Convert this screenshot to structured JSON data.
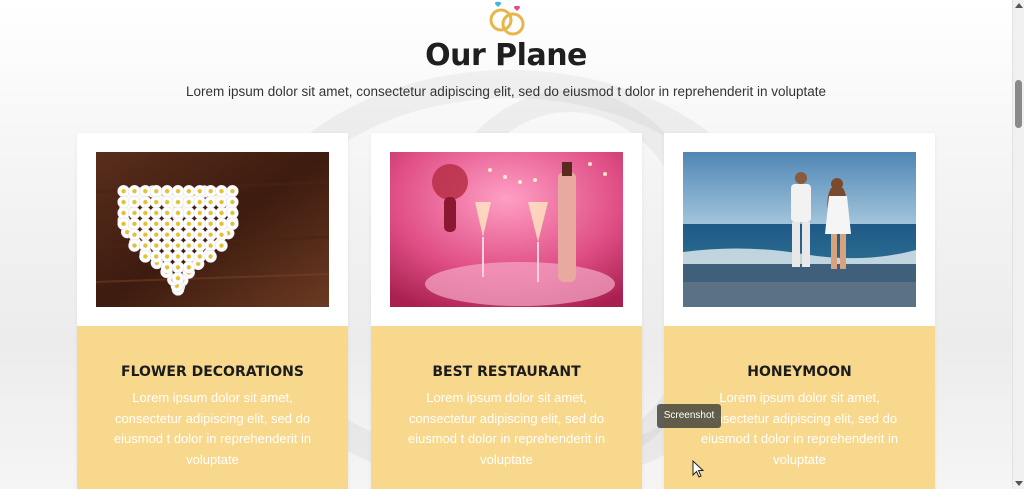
{
  "section": {
    "title": "Our Plane",
    "subtitle": "Lorem ipsum dolor sit amet, consectetur adipiscing elit, sed do eiusmod t dolor in reprehenderit in voluptate"
  },
  "cards": [
    {
      "title": "FLOWER DECORATIONS",
      "text": "Lorem ipsum dolor sit amet, consectetur adipiscing elit, sed do eiusmod t dolor in reprehenderit in voluptate",
      "image": "daisy-heart-on-wood"
    },
    {
      "title": "BEST RESTAURANT",
      "text": "Lorem ipsum dolor sit amet, consectetur adipiscing elit, sed do eiusmod t dolor in reprehenderit in voluptate",
      "image": "champagne-glasses-pink"
    },
    {
      "title": "HONEYMOON",
      "text": "Lorem ipsum dolor sit amet, consectetur adipiscing elit, sed do eiusmod t dolor in reprehenderit in voluptate",
      "image": "couple-on-beach"
    }
  ],
  "tooltip": {
    "text": "Screenshot"
  },
  "colors": {
    "card_lower": "#f7d88d",
    "title": "#1f1f1f",
    "accent_ring": "#e8b54a"
  },
  "icons": [
    "wedding-rings-icon",
    "mouse-cursor-icon"
  ]
}
